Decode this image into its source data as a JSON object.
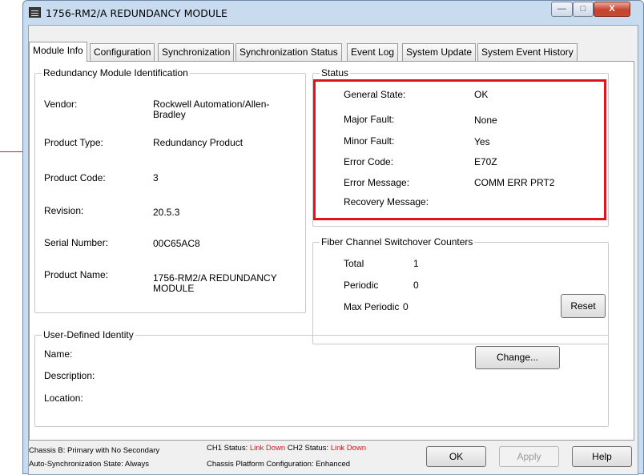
{
  "window": {
    "title": "1756-RM2/A REDUNDANCY MODULE",
    "min_glyph": "—",
    "max_glyph": "□",
    "close_glyph": "X"
  },
  "tabs": [
    {
      "label": "Module Info",
      "active": true
    },
    {
      "label": "Configuration"
    },
    {
      "label": "Synchronization"
    },
    {
      "label": "Synchronization Status"
    },
    {
      "label": "Event Log"
    },
    {
      "label": "System Update"
    },
    {
      "label": "System Event History"
    }
  ],
  "identification": {
    "legend": "Redundancy Module Identification",
    "vendor_label": "Vendor:",
    "vendor_value": "Rockwell Automation/Allen-Bradley",
    "product_type_label": "Product Type:",
    "product_type_value": "Redundancy Product",
    "product_code_label": "Product Code:",
    "product_code_value": "3",
    "revision_label": "Revision:",
    "revision_value": "20.5.3",
    "serial_label": "Serial Number:",
    "serial_value": "00C65AC8",
    "product_name_label": "Product Name:",
    "product_name_value": "1756-RM2/A REDUNDANCY MODULE"
  },
  "status": {
    "legend": "Status",
    "general_state_label": "General State:",
    "general_state_value": "OK",
    "major_fault_label": "Major Fault:",
    "major_fault_value": "None",
    "minor_fault_label": "Minor Fault:",
    "minor_fault_value": "Yes",
    "error_code_label": "Error Code:",
    "error_code_value": "E70Z",
    "error_message_label": "Error Message:",
    "error_message_value": "COMM ERR PRT2",
    "recovery_label": "Recovery Message:"
  },
  "fiber": {
    "legend": "Fiber Channel Switchover Counters",
    "total_label": "Total",
    "total_value": "1",
    "periodic_label": "Periodic",
    "periodic_value": "0",
    "max_periodic_label": "Max Periodic",
    "max_periodic_value": "0",
    "reset_label": "Reset"
  },
  "user_identity": {
    "legend": "User-Defined Identity",
    "name_label": "Name:",
    "description_label": "Description:",
    "location_label": "Location:",
    "change_label": "Change..."
  },
  "footer": {
    "chassis_b": "Chassis B: Primary with No Secondary",
    "auto_sync": "Auto-Synchronization State:  Always",
    "ch1_label": "CH1 Status:",
    "ch1_value": "Link Down",
    "ch2_label": "CH2 Status:",
    "ch2_value": "Link Down",
    "platform": "Chassis Platform Configuration:  Enhanced",
    "ok_label": "OK",
    "apply_label": "Apply",
    "help_label": "Help"
  },
  "colors": {
    "highlight": "#e1141d",
    "link_down": "#e1141d"
  }
}
